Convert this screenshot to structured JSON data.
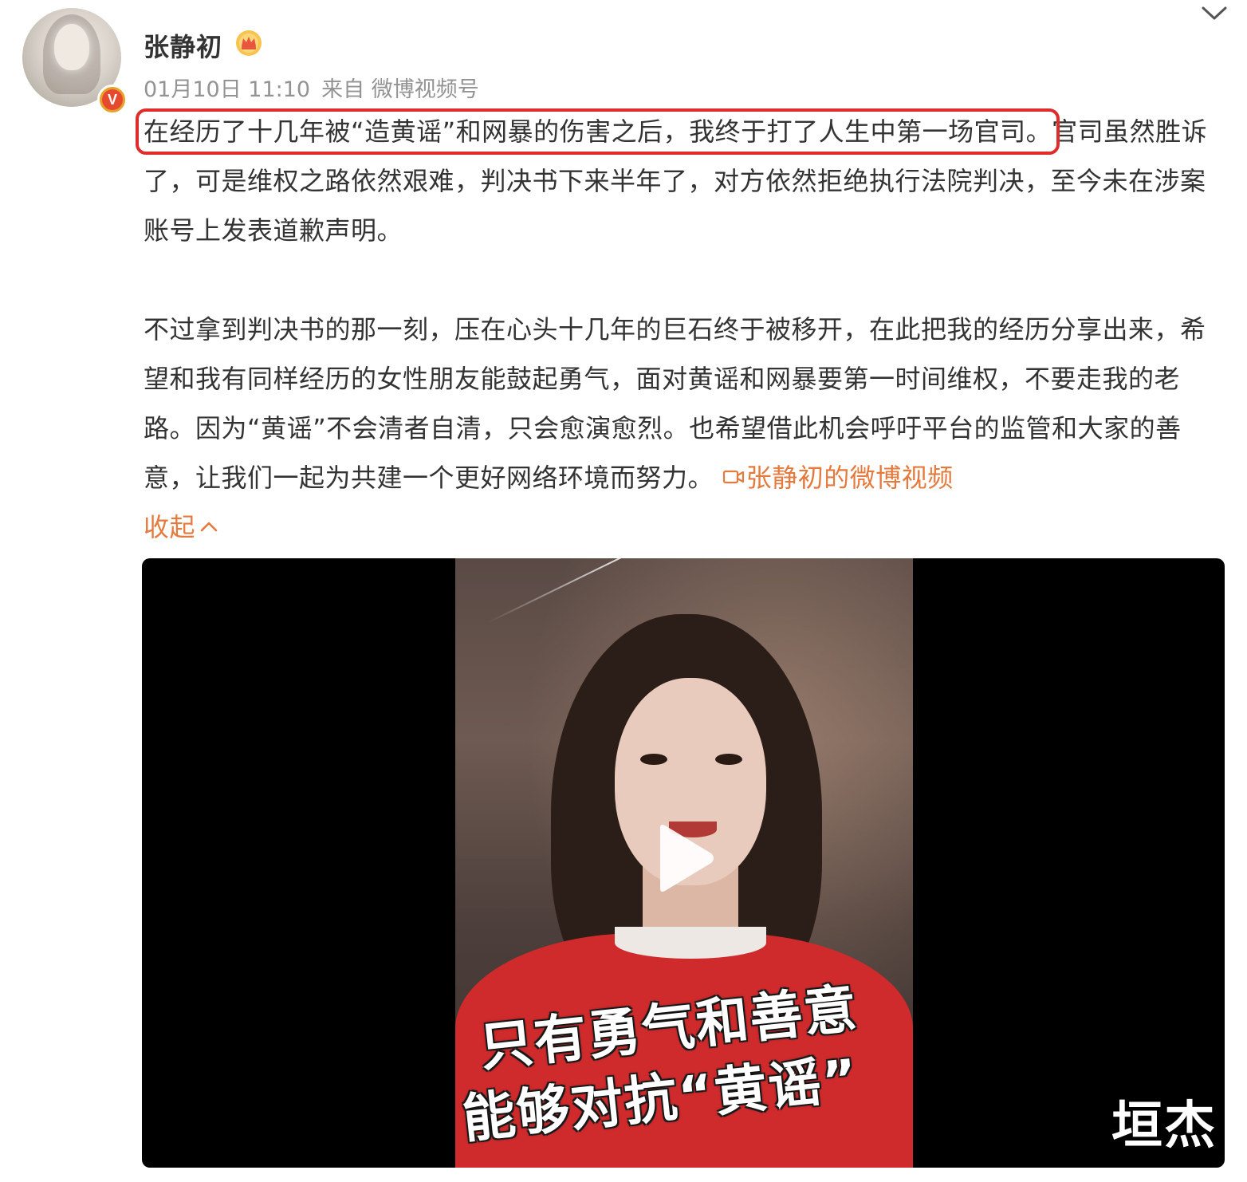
{
  "post": {
    "author": "张静初",
    "timestamp": "01月10日 11:10",
    "source": "来自 微博视频号",
    "text": {
      "highlighted": "在经历了十几年被“造黄谣”和网暴的伤害之后，我终于打了人生中第一场官司。",
      "rest_p1": "官司虽然胜诉了，可是维权之路依然艰难，判决书下来半年了，对方依然拒绝执行法院判决，至今未在涉案账号上发表道歉声明。",
      "p2": "不过拿到判决书的那一刻，压在心头十几年的巨石终于被移开，在此把我的经历分享出来，希望和我有同样经历的女性朋友能鼓起勇气，面对黄谣和网暴要第一时间维权，不要走我的老路。因为“黄谣”不会清者自清，只会愈演愈烈。也希望借此机会呼吁平台的监管和大家的善意，让我们一起为共建一个更好网络环境而努力。"
    },
    "video_link_label": "张静初的微博视频",
    "collapse_label": "收起"
  },
  "video": {
    "caption_line1": "只有勇气和善意",
    "caption_line2": "能够对抗“黄谣”"
  },
  "watermark": "垣杰",
  "colors": {
    "highlight_border": "#e02b2b",
    "link": "#e47a3d",
    "meta_text": "#939393",
    "body_text": "#333333",
    "video_bg": "#000000"
  },
  "icons": {
    "verified": "verified-badge-icon",
    "crown": "crown-icon",
    "dropdown": "chevron-down-icon",
    "video_camera": "video-camera-icon",
    "collapse": "chevron-up-icon",
    "play": "play-icon"
  }
}
